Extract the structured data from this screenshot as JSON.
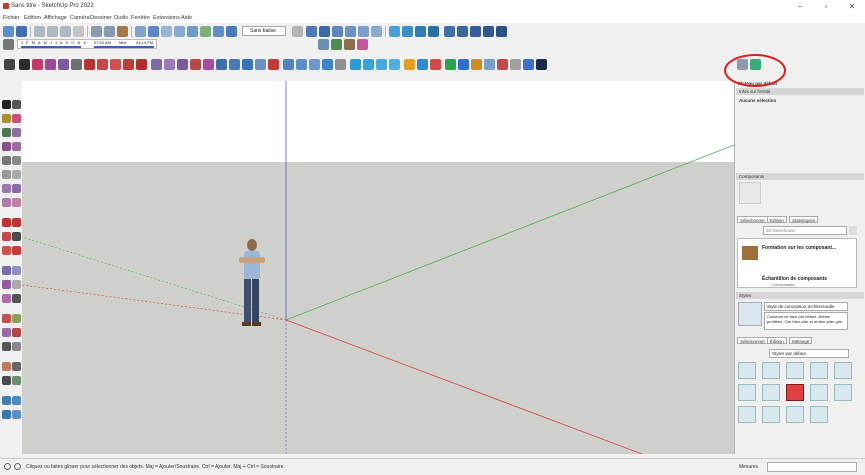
{
  "window": {
    "title": "Sans titre - SketchUp Pro 2022",
    "controls": [
      "–",
      "▫",
      "✕"
    ]
  },
  "menu": [
    "Fichier",
    "Edition",
    "Affichage",
    "Caméra",
    "Dessiner",
    "Outils",
    "Fenêtre",
    "Extensions",
    "Aide"
  ],
  "toolbar": {
    "style_select": "Sans balise",
    "timeline": {
      "months": "J F M A M J J A S O N D",
      "time_start": "07:53 AM",
      "midday": "Midi",
      "time_end": "04:14 PM"
    }
  },
  "tray": {
    "default_tray": "Plateau par défaut",
    "entity_info": {
      "header": "Infos sur l'entité",
      "selection": "Aucune sélection"
    },
    "components": {
      "header": "Composants",
      "tabs": [
        "Sélectionner",
        "Edition",
        "Statistiques"
      ],
      "search_placeholder": "3D Warehouse",
      "items": [
        {
          "title": "Formation sur les composant..."
        },
        {
          "title": "Échantillon de composants",
          "subtitle": "Composants"
        }
      ]
    },
    "styles": {
      "header": "Styles",
      "style_name": "Style de conception architecturale",
      "style_desc": "Couleurs de face par défaut. Arêtes profilées. Ciel bleu clair et arrière-plan gris.",
      "tabs": [
        "Sélectionner",
        "Édition",
        "Mélange"
      ],
      "dropdown": "Styles par défaut",
      "selected_index": 7
    }
  },
  "status": {
    "message": "Cliquez ou faites glisser pour sélectionner des objets. Maj = Ajouter/Soustraire. Ctrl = Ajouter. Maj + Ctrl = Soustraire.",
    "measure_label": "Mesures",
    "measure_value": ""
  },
  "colors": {
    "axis_red": "#d93b3b",
    "axis_green": "#4caf50",
    "axis_blue": "#4a5fd6",
    "ground": "#cfcfcb",
    "highlight": "#e21a1a"
  }
}
